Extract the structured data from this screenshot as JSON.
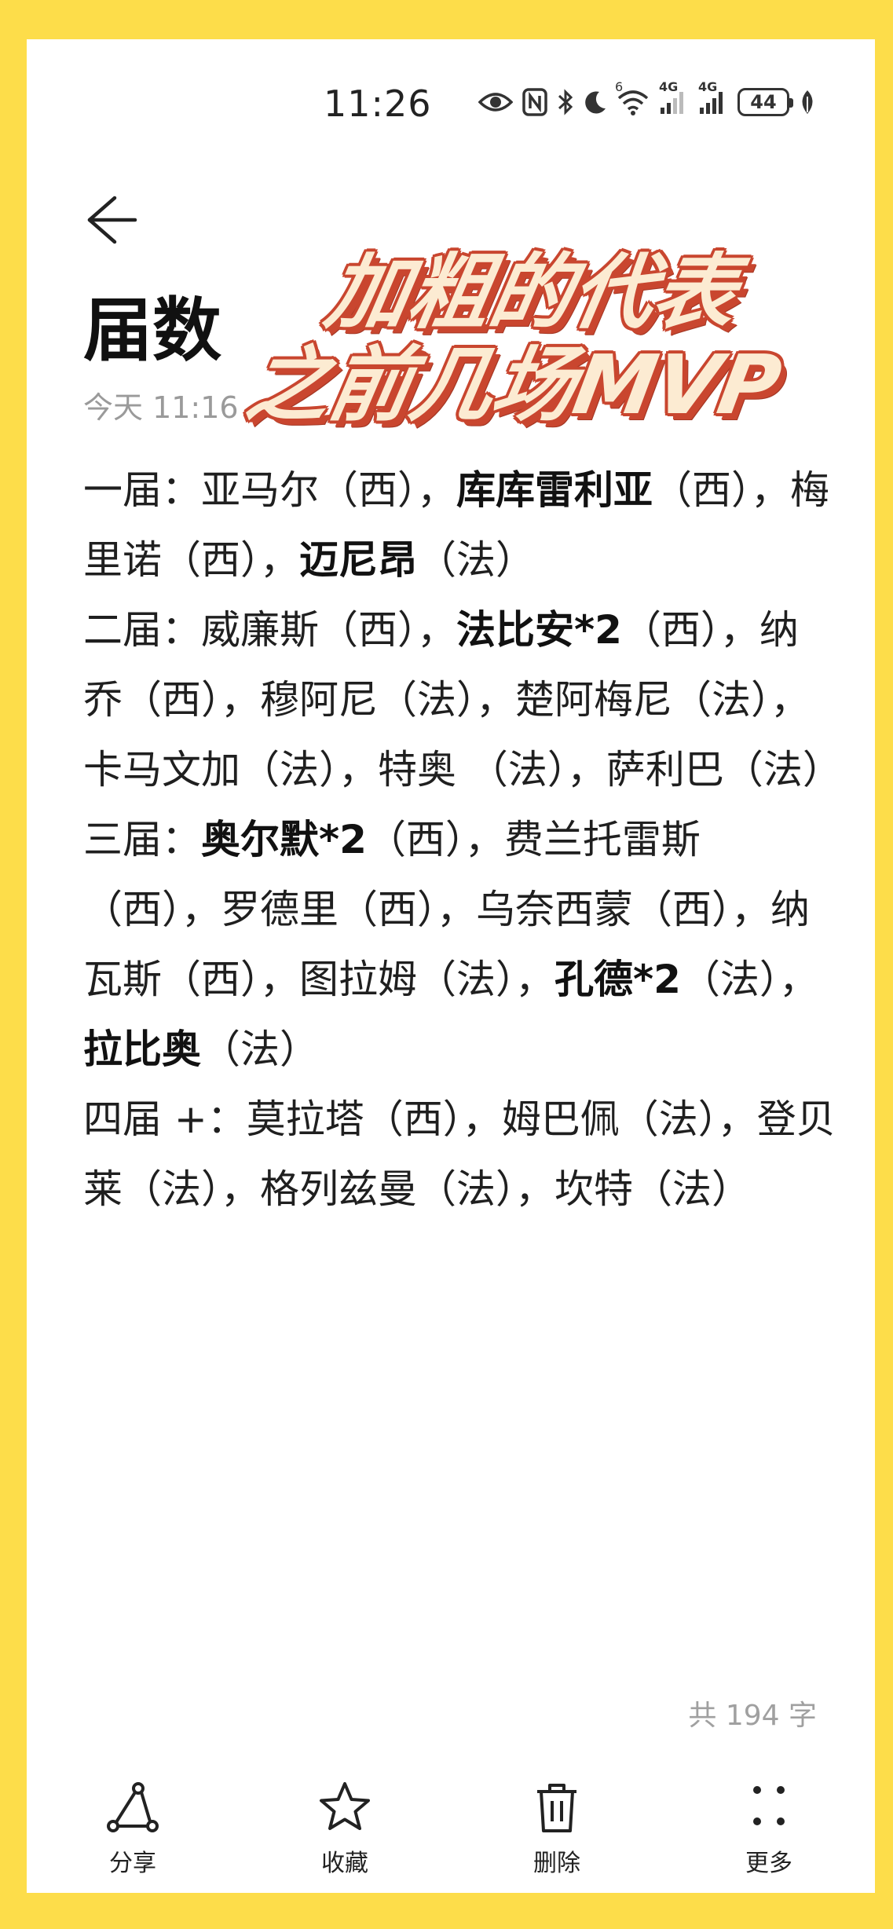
{
  "status_bar": {
    "time": "11:26",
    "net1": "6",
    "net2": "4G",
    "net3": "4G",
    "battery": "44"
  },
  "note": {
    "title": "届数",
    "meta": "今天 11:16",
    "overlay_line1": "加粗的代表",
    "overlay_line2": "之前几场MVP",
    "paragraphs": [
      [
        {
          "t": "一届：亚马尔（西），",
          "b": false
        },
        {
          "t": "库库雷利亚",
          "b": true
        },
        {
          "t": "（西），梅里诺（西），",
          "b": false
        },
        {
          "t": "迈尼昂",
          "b": true
        },
        {
          "t": "（法）",
          "b": false
        }
      ],
      [
        {
          "t": "二届：威廉斯（西），",
          "b": false
        },
        {
          "t": "法比安*2",
          "b": true
        },
        {
          "t": "（西），纳乔（西），穆阿尼（法），楚阿梅尼（法），卡马文加（法），特奥 （法），萨利巴（法）",
          "b": false
        }
      ],
      [
        {
          "t": "三届：",
          "b": false
        },
        {
          "t": "奥尔默*2",
          "b": true
        },
        {
          "t": "（西），费兰托雷斯（西），罗德里（西），乌奈西蒙（西），纳瓦斯（西），图拉姆（法），",
          "b": false
        },
        {
          "t": "孔德*2",
          "b": true
        },
        {
          "t": "（法），",
          "b": false
        },
        {
          "t": "拉比奥",
          "b": true
        },
        {
          "t": "（法）",
          "b": false
        }
      ],
      [
        {
          "t": "四届 +：莫拉塔（西），姆巴佩（法），登贝莱（法），格列兹曼（法），坎特（法）",
          "b": false
        }
      ]
    ],
    "word_count": "共 194 字"
  },
  "toolbar": {
    "share": "分享",
    "favorite": "收藏",
    "delete": "删除",
    "more": "更多"
  }
}
